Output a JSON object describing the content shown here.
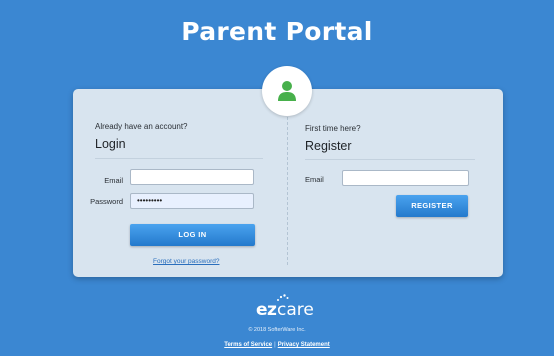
{
  "header": {
    "title": "Parent Portal"
  },
  "avatar": {
    "icon": "user-icon",
    "color": "#47b04b"
  },
  "login": {
    "prompt": "Already have an account?",
    "title": "Login",
    "email_label": "Email",
    "email_value": "",
    "password_label": "Password",
    "password_value": "•••••••••",
    "button_label": "LOG IN",
    "forgot_link": "Forgot your password?"
  },
  "register": {
    "prompt": "First time here?",
    "title": "Register",
    "email_label": "Email",
    "email_value": "",
    "button_label": "REGISTER"
  },
  "footer": {
    "logo_ez": "ez",
    "logo_care": "care",
    "copyright": "© 2018 SofterWare Inc.",
    "terms_link": "Terms of Service",
    "separator": "|",
    "privacy_link": "Privacy Statement"
  },
  "colors": {
    "background": "#3b87d2",
    "card": "#d8e4ef",
    "button": "#2f8de0",
    "link": "#2a6fbd"
  }
}
